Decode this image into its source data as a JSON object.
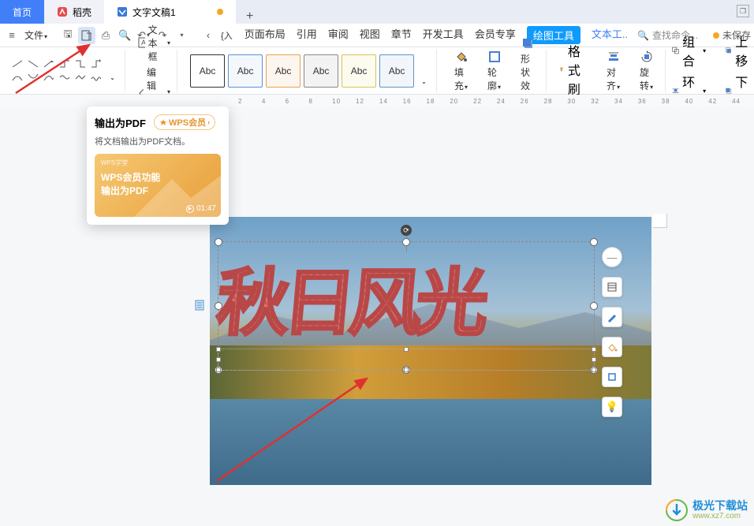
{
  "tabs": {
    "home": "首页",
    "daoqiao": "稻壳",
    "doc": "文字文稿1"
  },
  "menu": {
    "file": "文件",
    "items": [
      "页面布局",
      "引用",
      "审阅",
      "视图",
      "章节",
      "开发工具",
      "会员专享"
    ],
    "drawing_tools": "绘图工具",
    "text_tools": "文本工..",
    "search_placeholder": "查找命令...",
    "unsaved": "未保存"
  },
  "ribbon": {
    "textbox": "文本框",
    "editshape": "编辑形状",
    "abc": "Abc",
    "fill": "填充",
    "outline": "轮廓",
    "shape_effect": "形状效果",
    "format_painter": "格式刷",
    "align": "对齐",
    "rotate": "旋转",
    "group": "组合",
    "wrap": "环绕",
    "move_up": "上移",
    "move_down": "下移"
  },
  "ruler_ticks": [
    "2",
    "4",
    "6",
    "8",
    "10",
    "12",
    "14",
    "16",
    "18",
    "20",
    "22",
    "24",
    "26",
    "28",
    "30",
    "32",
    "34",
    "36",
    "38",
    "40",
    "42",
    "44"
  ],
  "tooltip": {
    "title": "输出为PDF",
    "vip": "WPS会员",
    "desc": "将文档输出为PDF文档。",
    "thumb_label": "WPS学堂",
    "thumb_line1": "WPS会员功能",
    "thumb_line2": "输出为PDF",
    "time": "01:47"
  },
  "wordart_text": "秋日风光",
  "watermark": {
    "name": "极光下载站",
    "url": "www.xz7.com"
  }
}
